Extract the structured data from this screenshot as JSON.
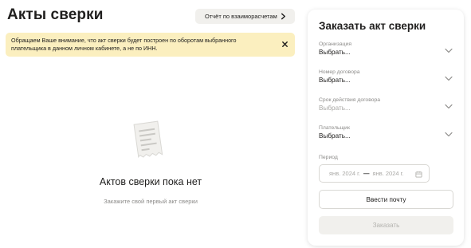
{
  "header": {
    "title": "Акты сверки",
    "report_button_label": "Отчёт по взаиморасчетам"
  },
  "notice": {
    "line1": "Обращаем Ваше внимание, что акт сверки будет построен по оборотам выбранного",
    "line2": "плательщика в данном личном кабинете, а не по ИНН."
  },
  "empty_state": {
    "title": "Актов сверки пока нет",
    "subtitle": "Закажите свой первый акт сверки"
  },
  "order_panel": {
    "title": "Заказать акт сверки",
    "fields": [
      {
        "label": "Организация",
        "value": "Выбрать..."
      },
      {
        "label": "Номер договора",
        "value": "Выбрать..."
      },
      {
        "label": "Срок действия договора",
        "value": "Выбрать..."
      },
      {
        "label": "Плательщик",
        "value": "Выбрать..."
      }
    ],
    "period": {
      "label": "Период",
      "from": "янв. 2024 г.",
      "separator": "—",
      "to": "янв. 2024 г."
    },
    "email_button_label": "Ввести почту",
    "submit_button_label": "Заказать"
  },
  "colors": {
    "notice_bg": "#fbefbf",
    "button_bg": "#f1f0ed",
    "text": "#21201f",
    "muted": "#8c8b89"
  },
  "icons": [
    "chevron-right-icon",
    "close-icon",
    "receipt-icon",
    "chevron-down-icon",
    "calendar-icon"
  ]
}
